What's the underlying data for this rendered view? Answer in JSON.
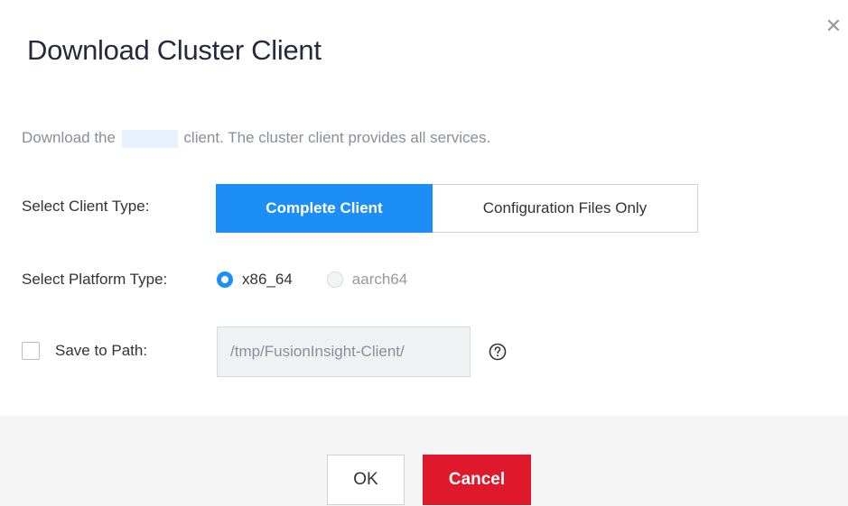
{
  "dialog": {
    "title": "Download Cluster Client",
    "close_icon": "close-icon"
  },
  "description": {
    "prefix": "Download the ",
    "cluster_name": "",
    "suffix": " client. The cluster client provides all services."
  },
  "client_type": {
    "label": "Select Client Type:",
    "options": [
      "Complete Client",
      "Configuration Files Only"
    ],
    "selected": "Complete Client"
  },
  "platform_type": {
    "label": "Select Platform Type:",
    "options": [
      "x86_64",
      "aarch64"
    ],
    "selected": "x86_64"
  },
  "save_path": {
    "label": "Save to Path:",
    "checked": false,
    "value": "/tmp/FusionInsight-Client/",
    "help_icon": "question-circle-icon"
  },
  "buttons": {
    "ok": "OK",
    "cancel": "Cancel"
  },
  "colors": {
    "primary": "#1e8ef7",
    "danger": "#e0182b",
    "footer_bg": "#f5f5f6"
  }
}
